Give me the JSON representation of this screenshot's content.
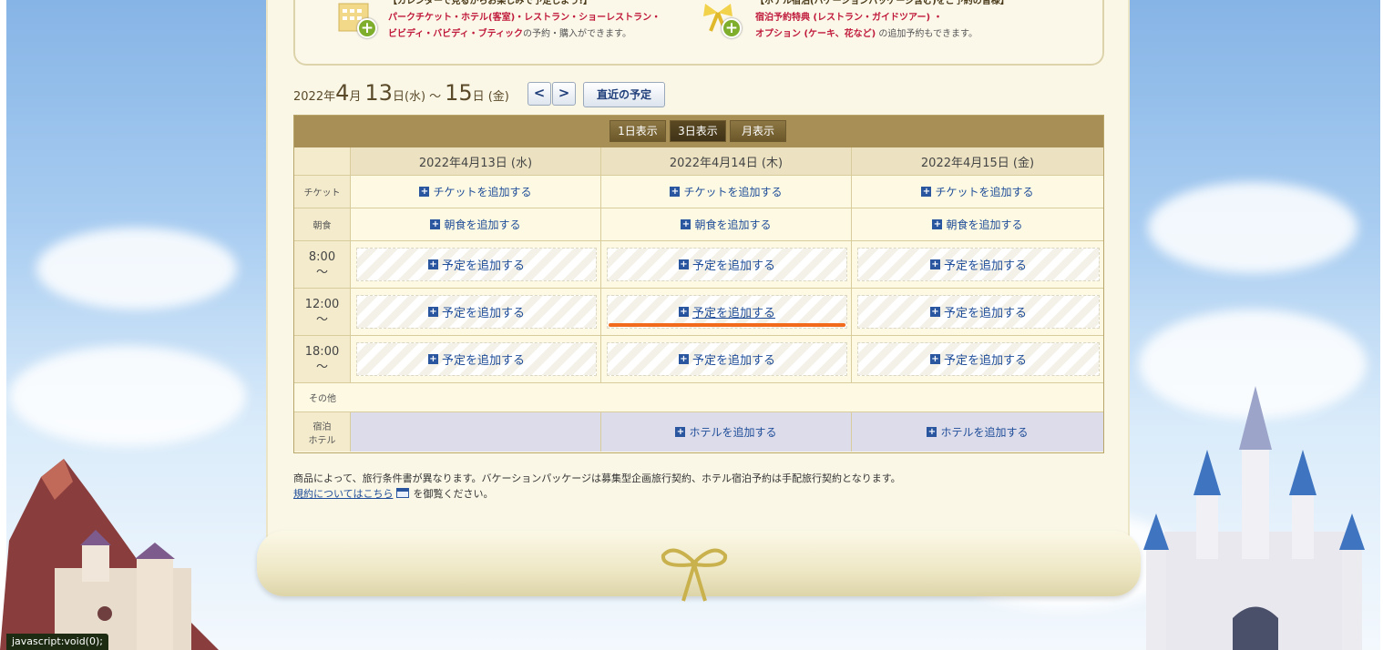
{
  "banner": {
    "left_heading": "【カレンダーで見るからお楽しみで予定しよう!】",
    "left_line1": "パークチケット・ホテル(客室)・レストラン・ショーレストラン・",
    "left_line2_bold": "ビビディ・バビディ・ブティック",
    "left_line2_rest": "の予約・購入ができます。",
    "right_heading": "【ホテル宿泊(バケーションパッケージ含む)をご予約の皆様】",
    "right_line1": "宿泊予約特典 (レストラン・ガイドツアー) ・",
    "right_line2_bold": "オプション (ケーキ、花など)",
    "right_line2_rest": " の追加予約もできます。"
  },
  "date_range": {
    "year": "2022年",
    "start_month": "4",
    "month_suffix": "月",
    "start_day": "13",
    "day_suffix": "日",
    "start_dow": "(水)",
    "tilde": "～",
    "end_day": "15",
    "end_dow": "(金)"
  },
  "nav": {
    "prev": "<",
    "next": ">",
    "recent": "直近の予定"
  },
  "view_tabs": [
    "1日表示",
    "3日表示",
    "月表示"
  ],
  "days": [
    "2022年4月13日 (水)",
    "2022年4月14日 (木)",
    "2022年4月15日 (金)"
  ],
  "rows": {
    "ticket": {
      "label": "チケット",
      "link": "チケットを追加する"
    },
    "breakfast": {
      "label": "朝食",
      "link": "朝食を追加する"
    },
    "slots": [
      {
        "time": "8:00",
        "tilde": "～"
      },
      {
        "time": "12:00",
        "tilde": "～"
      },
      {
        "time": "18:00",
        "tilde": "～"
      }
    ],
    "slot_link": "予定を追加する",
    "other": {
      "label": "その他"
    },
    "hotel": {
      "label_line1": "宿泊",
      "label_line2": "ホテル",
      "link": "ホテルを追加する"
    }
  },
  "plus_symbol": "+",
  "notes": {
    "line1": "商品によって、旅行条件書が異なります。バケーションパッケージは募集型企画旅行契約、ホテル宿泊予約は手配旅行契約となります。",
    "link": "規約についてはこちら",
    "line2_rest": "を御覧ください。"
  },
  "status_bar": "javascript:void(0);"
}
